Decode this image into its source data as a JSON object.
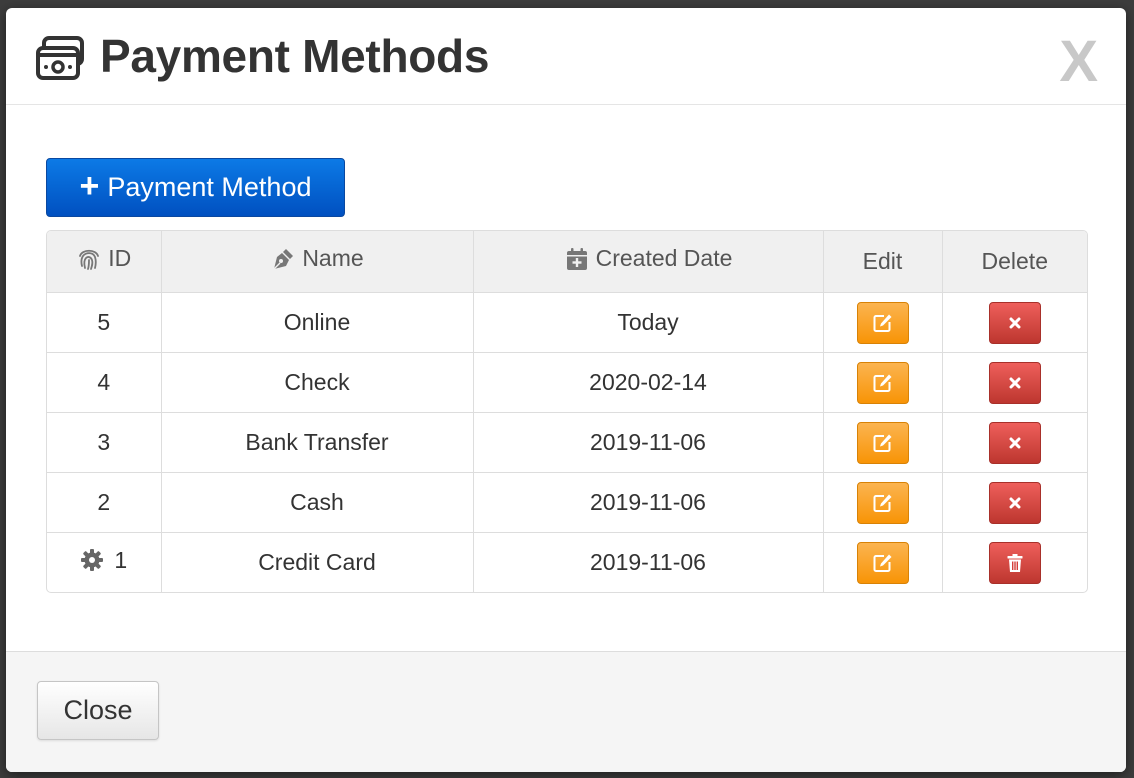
{
  "modal": {
    "title": "Payment Methods",
    "close_x": "X",
    "title_icon": "money-check-icon"
  },
  "toolbar": {
    "add_label": "Payment Method",
    "add_icon": "plus-icon"
  },
  "table": {
    "columns": [
      {
        "label": "ID",
        "icon": "fingerprint-icon"
      },
      {
        "label": "Name",
        "icon": "pen-nib-icon"
      },
      {
        "label": "Created Date",
        "icon": "calendar-plus-icon"
      },
      {
        "label": "Edit",
        "icon": ""
      },
      {
        "label": "Delete",
        "icon": ""
      }
    ],
    "rows": [
      {
        "id": "5",
        "name": "Online",
        "created": "Today",
        "delete_icon": "times-icon",
        "system": false
      },
      {
        "id": "4",
        "name": "Check",
        "created": "2020-02-14",
        "delete_icon": "times-icon",
        "system": false
      },
      {
        "id": "3",
        "name": "Bank Transfer",
        "created": "2019-11-06",
        "delete_icon": "times-icon",
        "system": false
      },
      {
        "id": "2",
        "name": "Cash",
        "created": "2019-11-06",
        "delete_icon": "times-icon",
        "system": false
      },
      {
        "id": "1",
        "name": "Credit Card",
        "created": "2019-11-06",
        "delete_icon": "trash-icon",
        "system": true
      }
    ]
  },
  "footer": {
    "close_label": "Close"
  },
  "colors": {
    "primary": "#0062d6",
    "warning": "#f89406",
    "danger": "#d9403a"
  }
}
